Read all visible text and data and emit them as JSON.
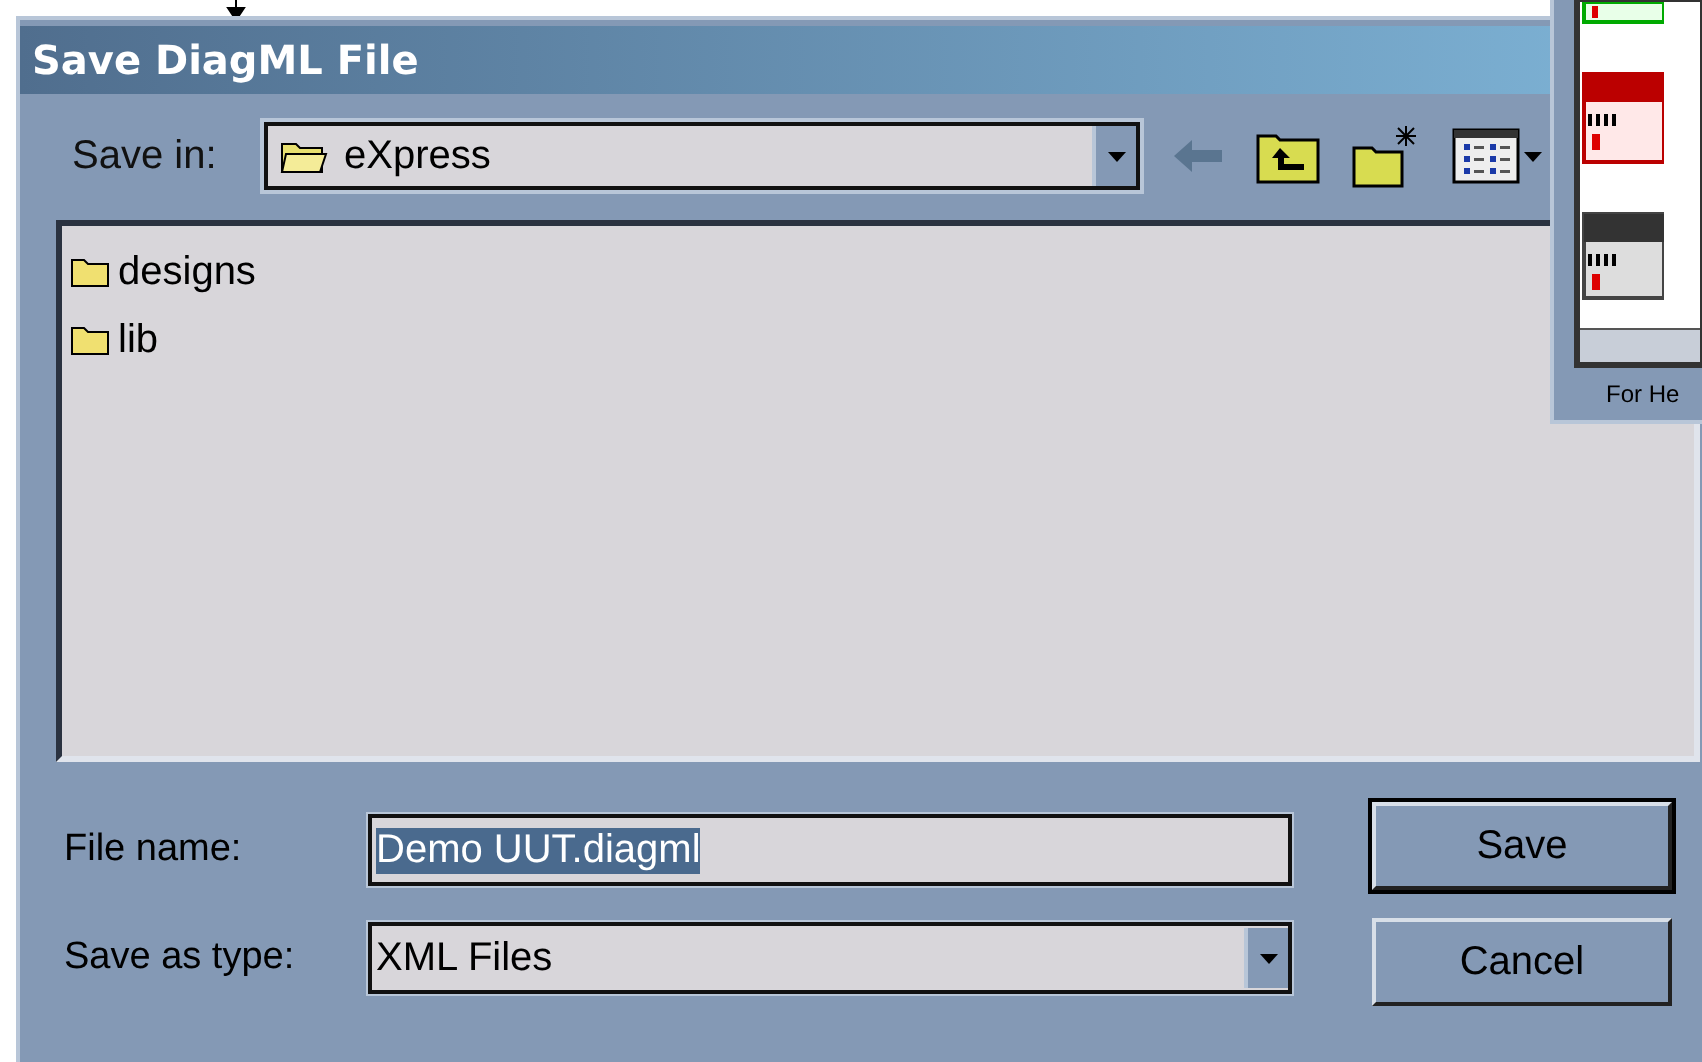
{
  "dialog": {
    "title": "Save DiagML File",
    "save_in": {
      "label": "Save in:",
      "value": "eXpress"
    },
    "files": [
      {
        "name": "designs",
        "selected": false
      },
      {
        "name": "lib",
        "selected": false
      }
    ],
    "file_name": {
      "label": "File name:",
      "value": "Demo UUT.diagml"
    },
    "save_as_type": {
      "label": "Save as type:",
      "value": "XML Files"
    },
    "buttons": [
      {
        "label": "Save",
        "default": true
      },
      {
        "label": "Cancel",
        "default": false
      }
    ]
  },
  "background_window": {
    "status_text": "For He"
  }
}
